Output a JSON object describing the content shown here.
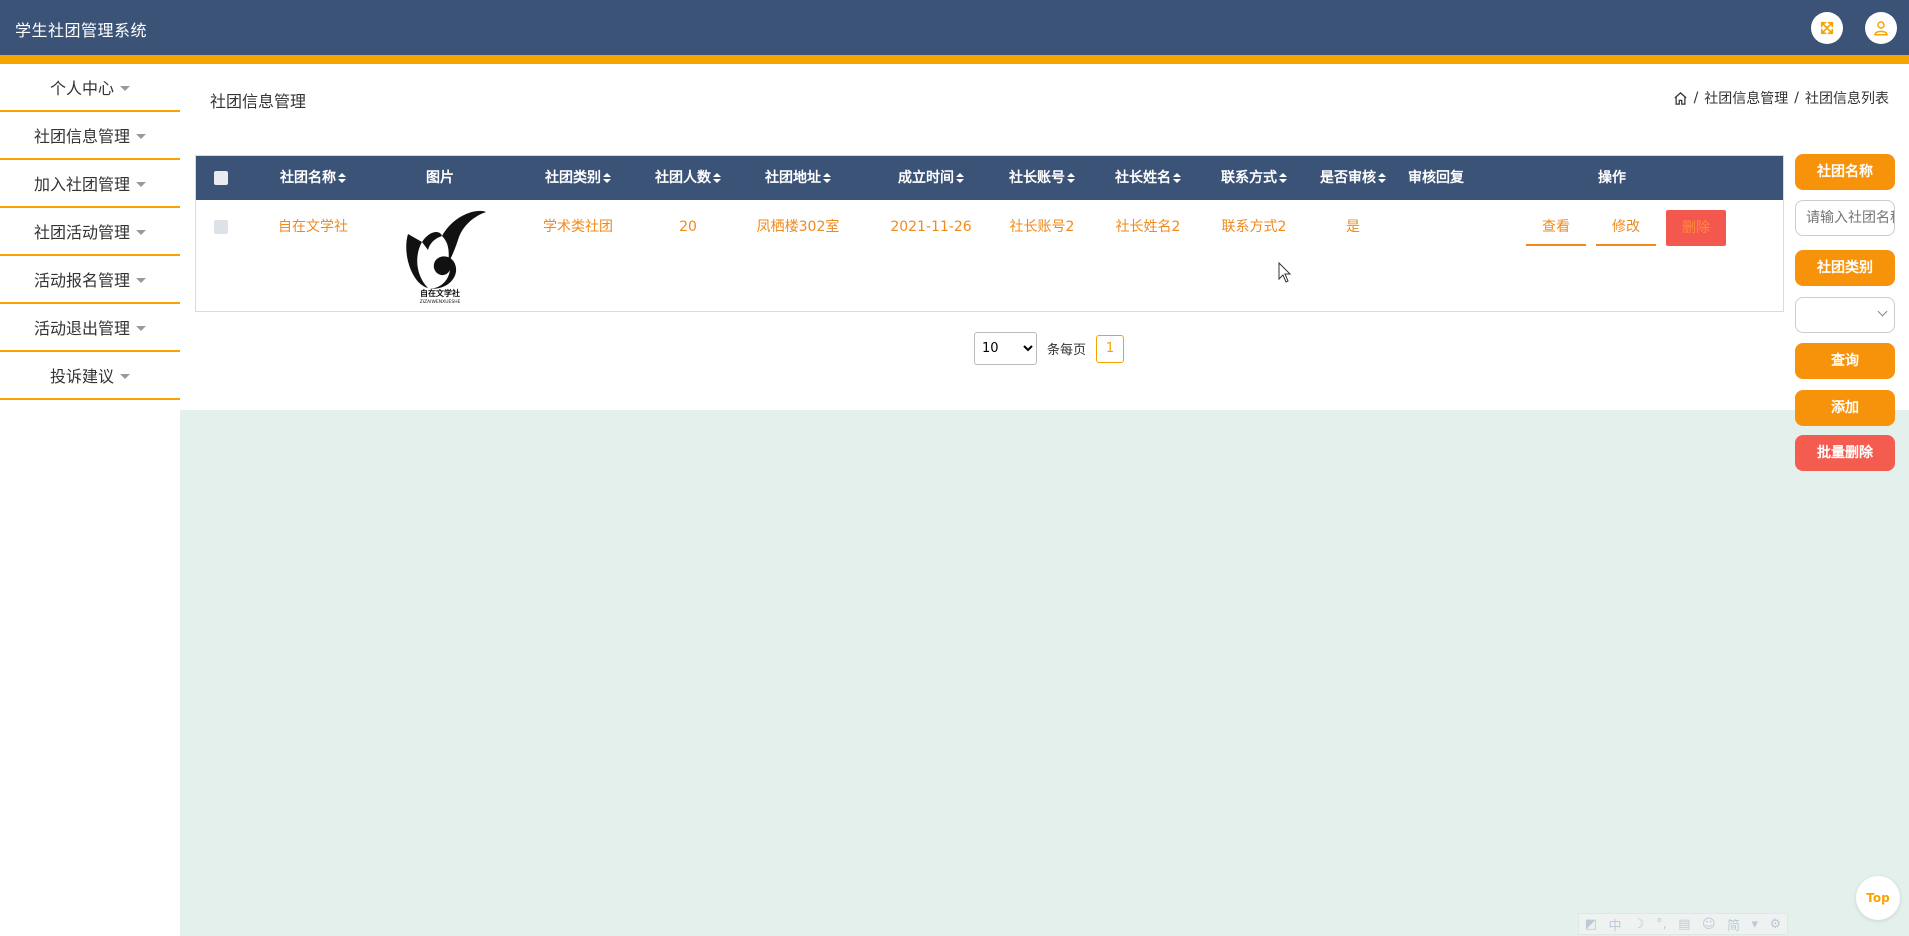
{
  "app": {
    "title": "学生社团管理系统"
  },
  "topbar": {
    "icons": [
      "fullscreen-icon",
      "user-icon"
    ],
    "accent_color": "#f7a400",
    "bg_color": "#3c5378"
  },
  "sidebar": {
    "items": [
      {
        "label": "个人中心"
      },
      {
        "label": "社团信息管理"
      },
      {
        "label": "加入社团管理"
      },
      {
        "label": "社团活动管理"
      },
      {
        "label": "活动报名管理"
      },
      {
        "label": "活动退出管理"
      },
      {
        "label": "投诉建议"
      }
    ]
  },
  "page": {
    "title": "社团信息管理",
    "breadcrumb": [
      "社团信息管理",
      "社团信息列表"
    ],
    "separator": "/"
  },
  "table": {
    "columns": [
      "社团名称",
      "图片",
      "社团类别",
      "社团人数",
      "社团地址",
      "成立时间",
      "社长账号",
      "社长姓名",
      "联系方式",
      "是否审核",
      "审核回复",
      "操作"
    ],
    "rows": [
      {
        "name": "自在文学社",
        "image_text": "自在文学社",
        "image_subtext": "ZIZAIWENXUESHE",
        "category": "学术类社团",
        "members": "20",
        "address": "凤栖楼302室",
        "founded": "2021-11-26",
        "leader_account": "社长账号2",
        "leader_name": "社长姓名2",
        "contact": "联系方式2",
        "reviewed": "是",
        "review_reply": "",
        "actions": {
          "view": "查看",
          "edit": "修改",
          "delete": "删除"
        }
      }
    ]
  },
  "pagination": {
    "page_size": "10",
    "page_size_options": [
      "10"
    ],
    "per_page_label": "条每页",
    "current_page": "1"
  },
  "search_panel": {
    "name_button": "社团名称",
    "name_placeholder": "请输入社团名称",
    "category_button": "社团类别",
    "category_value": "",
    "query_button": "查询",
    "add_button": "添加",
    "batch_delete_button": "批量删除"
  },
  "back_to_top": "Top",
  "ime_toolbar": [
    "中",
    "简"
  ]
}
